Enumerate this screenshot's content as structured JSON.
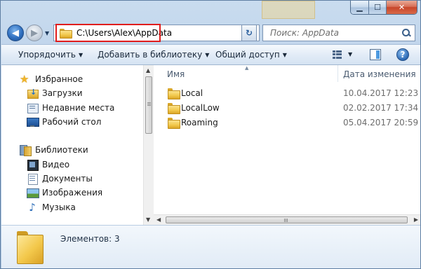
{
  "window": {
    "controls": {
      "minimize": "▁",
      "maximize": "☐",
      "close": "✕"
    }
  },
  "nav": {
    "back_glyph": "◀",
    "forward_glyph": "▶",
    "recent_glyph": "▼",
    "address": "C:\\Users\\Alex\\AppData",
    "address_dropdown_glyph": "▼",
    "refresh_glyph": "↻",
    "search_placeholder": "Поиск: AppData"
  },
  "toolbar": {
    "organize": "Упорядочить",
    "add_to_library": "Добавить в библиотеку",
    "share": "Общий доступ",
    "caret": "▼",
    "help": "?"
  },
  "sidebar": {
    "favorites_header": "Избранное",
    "favorites": [
      {
        "label": "Загрузки",
        "icon": "downloads-icon"
      },
      {
        "label": "Недавние места",
        "icon": "recent-places-icon"
      },
      {
        "label": "Рабочий стол",
        "icon": "desktop-icon"
      }
    ],
    "libraries_header": "Библиотеки",
    "libraries": [
      {
        "label": "Видео",
        "icon": "video-icon"
      },
      {
        "label": "Документы",
        "icon": "documents-icon"
      },
      {
        "label": "Изображения",
        "icon": "images-icon"
      },
      {
        "label": "Музыка",
        "icon": "music-icon"
      }
    ]
  },
  "files": {
    "columns": {
      "name": "Имя",
      "date": "Дата изменения"
    },
    "rows": [
      {
        "name": "Local",
        "date": "10.04.2017 12:23"
      },
      {
        "name": "LocalLow",
        "date": "02.02.2017 17:34"
      },
      {
        "name": "Roaming",
        "date": "05.04.2017 20:59"
      }
    ]
  },
  "status": {
    "items_count": "Элементов: 3"
  },
  "colors": {
    "accent": "#2f6fbf",
    "highlight_border": "#e01c1c",
    "folder": "#f1c74a"
  }
}
